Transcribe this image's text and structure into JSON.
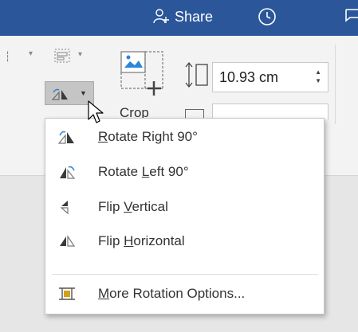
{
  "titlebar": {
    "share_label": "Share",
    "colors": {
      "background": "#2b579a",
      "text": "#ffffff"
    },
    "icons": [
      "add-person-icon",
      "history-icon",
      "comment-icon"
    ]
  },
  "ribbon": {
    "arrange": {
      "rotate_button_icon": "rotate-right-icon",
      "align_icon": "align-icon"
    },
    "size": {
      "crop_label": "Crop",
      "height_value": "10.93 cm",
      "width_value": ""
    }
  },
  "rotate_menu": {
    "items": [
      {
        "label": "Rotate Right 90°",
        "access_key": "R",
        "icon": "rotate-right-icon"
      },
      {
        "label": "Rotate Left 90°",
        "access_key": "L",
        "icon": "rotate-left-icon"
      },
      {
        "label": "Flip Vertical",
        "access_key": "V",
        "icon": "flip-vertical-icon"
      },
      {
        "label": "Flip Horizontal",
        "access_key": "H",
        "icon": "flip-horizontal-icon"
      },
      {
        "label": "More Rotation Options...",
        "access_key": "M",
        "icon": "more-rotation-options-icon"
      }
    ]
  }
}
